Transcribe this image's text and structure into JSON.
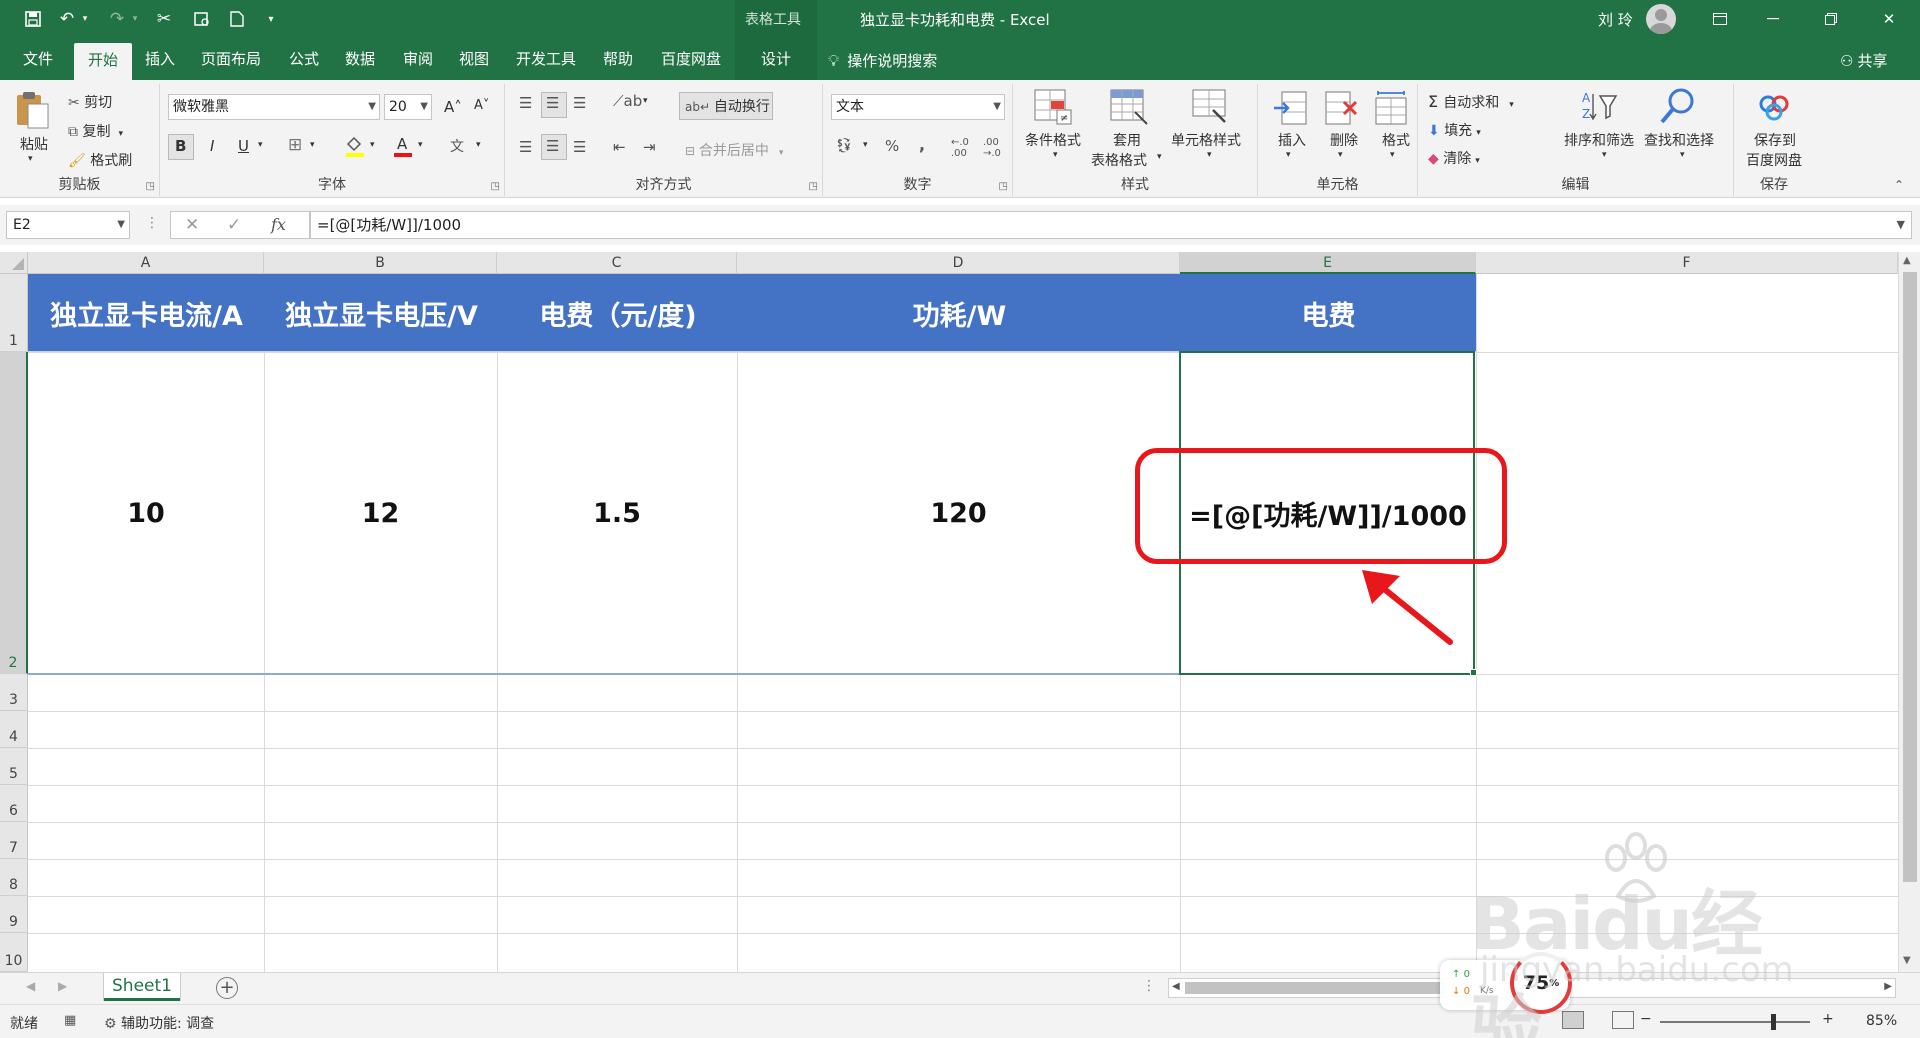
{
  "app": {
    "context_tool_label": "表格工具",
    "document_title": "独立显卡功耗和电费 - Excel",
    "user_name": "刘 玲"
  },
  "menu": {
    "tabs": [
      "文件",
      "开始",
      "插入",
      "页面布局",
      "公式",
      "数据",
      "审阅",
      "视图",
      "开发工具",
      "帮助",
      "百度网盘",
      "设计"
    ],
    "active_tab": "开始",
    "search_label": "操作说明搜索",
    "share_label": "共享"
  },
  "ribbon": {
    "clipboard": {
      "label": "剪贴板",
      "paste": "粘贴",
      "cut": "剪切",
      "copy": "复制",
      "format_painter": "格式刷"
    },
    "font": {
      "label": "字体",
      "font_name": "微软雅黑",
      "font_size": "20",
      "bold": "B",
      "italic": "I",
      "underline": "U"
    },
    "alignment": {
      "label": "对齐方式",
      "wrap_text": "自动换行",
      "merge_center": "合并后居中"
    },
    "number": {
      "label": "数字",
      "format": "文本"
    },
    "styles": {
      "label": "样式",
      "conditional": "条件格式",
      "table_format_1": "套用",
      "table_format_2": "表格格式",
      "cell_styles": "单元格样式"
    },
    "cells": {
      "label": "单元格",
      "insert": "插入",
      "delete": "删除",
      "format": "格式"
    },
    "editing": {
      "label": "编辑",
      "autosum": "自动求和",
      "fill": "填充",
      "clear": "清除",
      "sort_filter": "排序和筛选",
      "find_select": "查找和选择"
    },
    "save": {
      "label": "保存",
      "save_baidu_1": "保存到",
      "save_baidu_2": "百度网盘"
    }
  },
  "formula_bar": {
    "name_box": "E2",
    "fx": "fx",
    "formula": "=[@[功耗/W]]/1000"
  },
  "sheet": {
    "columns": [
      "A",
      "B",
      "C",
      "D",
      "E",
      "F"
    ],
    "selected_column": "E",
    "rows": [
      "1",
      "2",
      "3",
      "4",
      "5",
      "6",
      "7",
      "8",
      "9",
      "10"
    ],
    "headers": [
      "独立显卡电流/A",
      "独立显卡电压/V",
      "电费（元/度)",
      "功耗/W",
      "电费"
    ],
    "data_row": [
      "10",
      "12",
      "1.5",
      "120",
      "=[@[功耗/W]]/1000"
    ],
    "header_fill_color": "#4472c4",
    "annotation_color": "#e8171b"
  },
  "sheet_tabs": {
    "active": "Sheet1"
  },
  "status": {
    "ready": "就绪",
    "accessibility": "辅助功能: 调查",
    "zoom": "85%"
  },
  "overlay": {
    "net_up": "0",
    "net_down": "0",
    "net_unit": "K/s",
    "gauge": "75",
    "gauge_unit": "%",
    "watermark_logo": "Baidu经验",
    "watermark_url": "jingyan.baidu.com"
  }
}
